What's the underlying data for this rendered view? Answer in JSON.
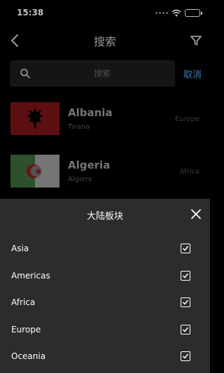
{
  "status_bar": {
    "time": "15:38",
    "battery_level": 1.0
  },
  "navbar": {
    "title": "搜索"
  },
  "search": {
    "placeholder": "搜索",
    "cancel_label": "取消"
  },
  "countries": [
    {
      "name": "Albania",
      "capital": "Tirana",
      "region": "Europe",
      "flag": "flag-albania"
    },
    {
      "name": "Algeria",
      "capital": "Algiers",
      "region": "Africa",
      "flag": "flag-algeria"
    }
  ],
  "filter_sheet": {
    "title": "大陆板块",
    "options": [
      {
        "label": "Asia",
        "checked": true
      },
      {
        "label": "Americas",
        "checked": true
      },
      {
        "label": "Africa",
        "checked": true
      },
      {
        "label": "Europe",
        "checked": true
      },
      {
        "label": "Oceania",
        "checked": true
      }
    ]
  },
  "colors": {
    "accent": "#3a6fa8",
    "sheet_bg": "#2c2c2e",
    "page_bg": "#000000"
  }
}
